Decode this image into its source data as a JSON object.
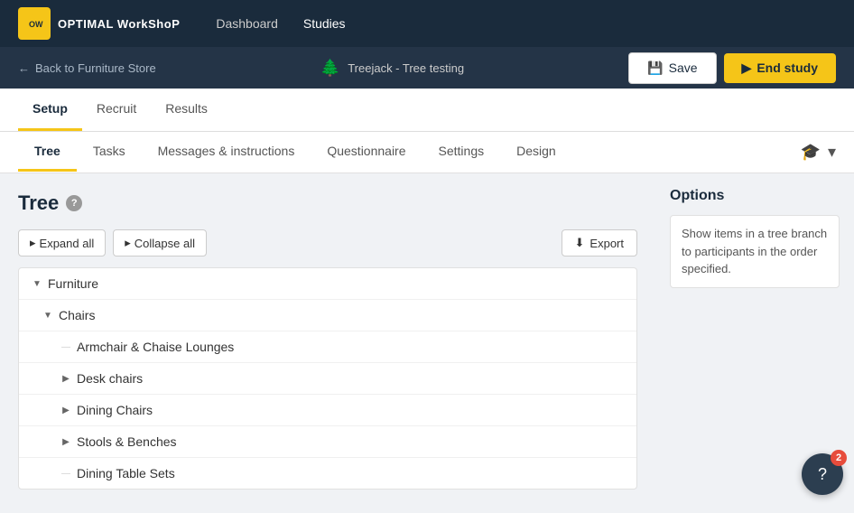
{
  "topNav": {
    "logo": {
      "iconText": "OW",
      "text": "OPTIMAL WorkShoP"
    },
    "links": [
      {
        "id": "dashboard",
        "label": "Dashboard",
        "active": false
      },
      {
        "id": "studies",
        "label": "Studies",
        "active": true
      }
    ]
  },
  "subHeader": {
    "backLabel": "Back to Furniture Store",
    "studyName": "Treejack - Tree testing"
  },
  "actionButtons": {
    "saveLabel": "Save",
    "endStudyLabel": "End study"
  },
  "setupTabs": [
    {
      "id": "setup",
      "label": "Setup",
      "active": true
    },
    {
      "id": "recruit",
      "label": "Recruit",
      "active": false
    },
    {
      "id": "results",
      "label": "Results",
      "active": false
    }
  ],
  "sectionTabs": [
    {
      "id": "tree",
      "label": "Tree",
      "active": true
    },
    {
      "id": "tasks",
      "label": "Tasks",
      "active": false
    },
    {
      "id": "messages",
      "label": "Messages & instructions",
      "active": false
    },
    {
      "id": "questionnaire",
      "label": "Questionnaire",
      "active": false
    },
    {
      "id": "settings",
      "label": "Settings",
      "active": false
    },
    {
      "id": "design",
      "label": "Design",
      "active": false
    }
  ],
  "pageTitle": "Tree",
  "helpTooltip": "?",
  "toolbar": {
    "expandAll": "Expand all",
    "collapseAll": "Collapse all",
    "export": "Export"
  },
  "options": {
    "title": "Options",
    "infoText": "Show items in a tree branch to participants in the order specified."
  },
  "treeItems": [
    {
      "id": "furniture",
      "label": "Furniture",
      "indent": 0,
      "toggle": "▼",
      "expanded": true
    },
    {
      "id": "chairs",
      "label": "Chairs",
      "indent": 1,
      "toggle": "▼",
      "expanded": true
    },
    {
      "id": "armchair",
      "label": "Armchair & Chaise Lounges",
      "indent": 2,
      "toggle": "–",
      "expanded": false
    },
    {
      "id": "desk-chairs",
      "label": "Desk chairs",
      "indent": 2,
      "toggle": "▶",
      "expanded": false
    },
    {
      "id": "dining-chairs",
      "label": "Dining Chairs",
      "indent": 2,
      "toggle": "▶",
      "expanded": false
    },
    {
      "id": "stools",
      "label": "Stools & Benches",
      "indent": 2,
      "toggle": "▶",
      "expanded": false
    },
    {
      "id": "dining-table",
      "label": "Dining Table Sets",
      "indent": 2,
      "toggle": "–",
      "expanded": false
    }
  ],
  "helpBubble": {
    "badgeCount": "2",
    "icon": "?"
  }
}
